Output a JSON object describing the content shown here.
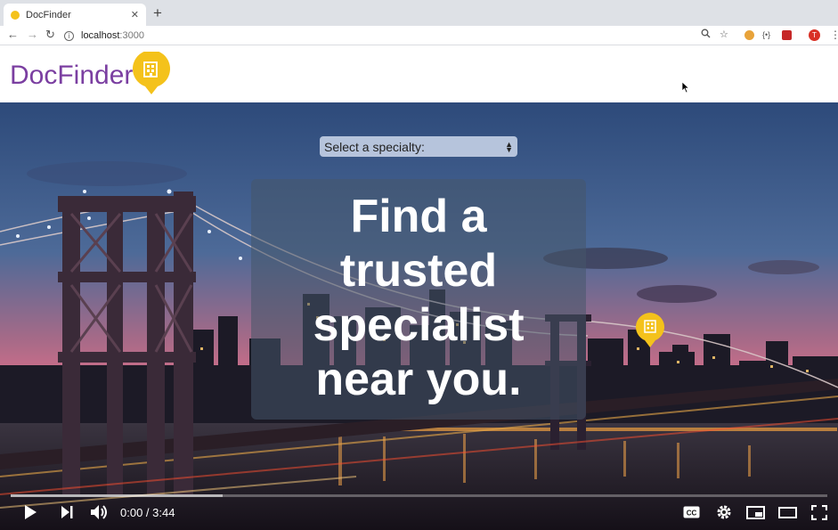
{
  "browser": {
    "tab_title": "DocFinder",
    "url_host": "localhost",
    "url_port": ":3000",
    "profile_initial": "T"
  },
  "site": {
    "logo_text": "DocFinder",
    "brand_purple": "#7b3fa1",
    "brand_yellow": "#f4c21b"
  },
  "hero": {
    "select_placeholder": "Select a specialty:",
    "headline_lines": [
      "Find a",
      "trusted",
      "specialist",
      "near you."
    ]
  },
  "video": {
    "time_display": "0:00 / 3:44",
    "buffered_fraction": 0.26
  }
}
